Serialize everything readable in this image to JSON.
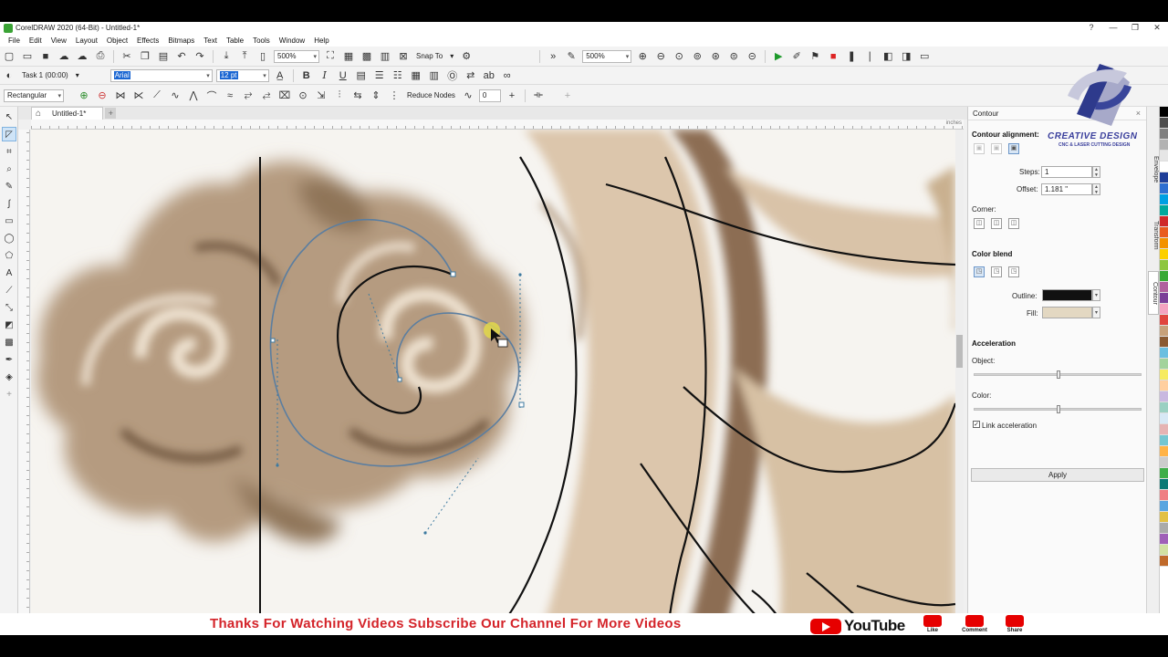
{
  "window": {
    "title": "CorelDRAW 2020 (64-Bit) - Untitled-1*",
    "controls": [
      "?",
      "—",
      "❐",
      "✕"
    ]
  },
  "menu": [
    "File",
    "Edit",
    "View",
    "Layout",
    "Object",
    "Effects",
    "Bitmaps",
    "Text",
    "Table",
    "Tools",
    "Window",
    "Help"
  ],
  "toolbar1": {
    "zoom_left": "500%",
    "snap_to": "Snap To",
    "zoom_right": "500%"
  },
  "toolbar2": {
    "task": "Task 1 (00:00)",
    "font": "Arial",
    "size": "12 pt"
  },
  "toolbar3": {
    "shape": "Rectangular",
    "reduce_nodes": "Reduce Nodes",
    "curve_smooth": "0"
  },
  "document": {
    "tab": "Untitled-1*",
    "ruler_unit": "inches"
  },
  "docker": {
    "title": "Contour",
    "alignment_heading": "Contour alignment:",
    "steps_label": "Steps:",
    "steps_value": "1",
    "offset_label": "Offset:",
    "offset_value": "1.181 \"",
    "corner_heading": "Corner:",
    "color_blend_heading": "Color blend",
    "outline_label": "Outline:",
    "fill_label": "Fill:",
    "outline_color": "#111111",
    "fill_color": "#e3d8c2",
    "acceleration_heading": "Acceleration",
    "object_label": "Object:",
    "color_label": "Color:",
    "link_acceleration": "Link acceleration",
    "object_accel": 0.5,
    "color_accel": 0.5,
    "apply": "Apply"
  },
  "docker_tabs": [
    "Envelope",
    "Transform",
    "Contour"
  ],
  "palette": [
    "#000000",
    "#4d4d4d",
    "#808080",
    "#b3b3b3",
    "#e6e6e6",
    "#ffffff",
    "#1f3f99",
    "#2e6fd1",
    "#00a0e3",
    "#00a99d",
    "#cf2a2a",
    "#e95c1f",
    "#f39200",
    "#fcd000",
    "#8dc63f",
    "#39a935",
    "#b0609e",
    "#7b3f98",
    "#f4a3c0",
    "#e0453e",
    "#c7a17a",
    "#8a5a32",
    "#6abfe0",
    "#a3d39c",
    "#f6eb61",
    "#ffcfa0",
    "#c9b8e0",
    "#9ad0c2",
    "#d7e8f5",
    "#e5b3b3",
    "#74c6d1",
    "#ffb347",
    "#cccccc",
    "#3fae49",
    "#0b7a75",
    "#ef7f83",
    "#5aa6e0",
    "#e2c044",
    "#aaaaaa",
    "#a05fb8",
    "#d2e0a2",
    "#c06a2b"
  ],
  "logo": {
    "name": "CREATIVE DESIGN",
    "tagline": "CNC & LASER CUTTING DESIGN"
  },
  "banner": {
    "message": "Thanks For Watching Videos Subscribe Our Channel For More Videos",
    "youtube": "YouTube",
    "like": "Like",
    "comment": "Comment",
    "share": "Share"
  }
}
